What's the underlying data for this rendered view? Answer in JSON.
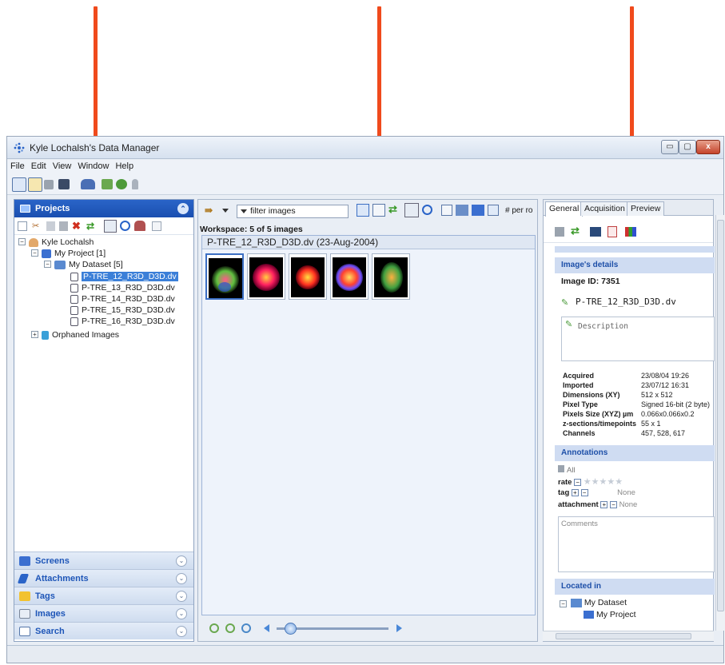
{
  "window": {
    "title": "Kyle Lochalsh's Data Manager",
    "controls": {
      "minimize": "▭",
      "maximize": "▢",
      "close": "x"
    }
  },
  "menu": [
    "File",
    "Edit",
    "View",
    "Window",
    "Help"
  ],
  "left_panel": {
    "title": "Projects",
    "tree": {
      "user": "Kyle Lochalsh",
      "project": "My Project [1]",
      "dataset": "My Dataset [5]",
      "images": [
        "P-TRE_12_R3D_D3D.dv",
        "P-TRE_13_R3D_D3D.dv",
        "P-TRE_14_R3D_D3D.dv",
        "P-TRE_15_R3D_D3D.dv",
        "P-TRE_16_R3D_D3D.dv"
      ],
      "selected_index": 0,
      "orphaned": "Orphaned Images"
    },
    "accordion": [
      "Screens",
      "Attachments",
      "Tags",
      "Images",
      "Search"
    ]
  },
  "center_panel": {
    "filter_placeholder": "filter  images",
    "per_row_label": "# per ro",
    "workspace_label": "Workspace: 5 of 5 images",
    "image_header": "P-TRE_12_R3D_D3D.dv (23-Aug-2004)",
    "thumbnail_count": 5
  },
  "right_panel": {
    "tabs": [
      "General",
      "Acquisition",
      "Preview"
    ],
    "active_tab": 0,
    "details_title": "Image's details",
    "image_id": "Image ID: 7351",
    "image_name": "P-TRE_12_R3D_D3D.dv",
    "description_placeholder": "Description",
    "details": [
      {
        "key": "Acquired",
        "value": "23/08/04 19:26"
      },
      {
        "key": "Imported",
        "value": "23/07/12 16:31"
      },
      {
        "key": "Dimensions (XY)",
        "value": "512 x 512"
      },
      {
        "key": "Pixel Type",
        "value": "Signed 16-bit (2 byte)"
      },
      {
        "key": "Pixels Size (XYZ) µm",
        "value": "0.066x0.066x0.2"
      },
      {
        "key": "z-sections/timepoints",
        "value": "55 x 1"
      },
      {
        "key": "Channels",
        "value": "457, 528, 617"
      }
    ],
    "annotations_title": "Annotations",
    "all_label": "All",
    "rate_label": "rate",
    "rating": 0,
    "tag_label": "tag",
    "tag_value": "None",
    "attachment_label": "attachment",
    "attachment_value": "None",
    "comments_placeholder": "Comments",
    "located_in_title": "Located in",
    "located_dataset": "My Dataset",
    "located_project": "My Project"
  },
  "colors": {
    "arrow": "#f04a1c",
    "panel_header": "#1a4fb0",
    "selection": "#3b7fd8"
  }
}
